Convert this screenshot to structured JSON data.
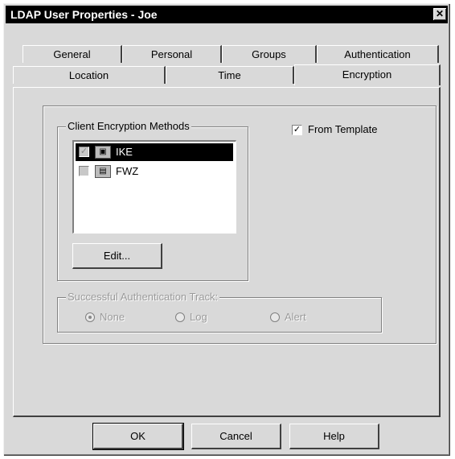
{
  "window": {
    "title": "LDAP User Properties - Joe",
    "close_glyph": "✕"
  },
  "tabs_row1": [
    {
      "label": "General"
    },
    {
      "label": "Personal"
    },
    {
      "label": "Groups"
    },
    {
      "label": "Authentication"
    }
  ],
  "tabs_row2": [
    {
      "label": "Location"
    },
    {
      "label": "Time"
    },
    {
      "label": "Encryption",
      "active": true
    }
  ],
  "client_encryption": {
    "group_label": "Client Encryption Methods",
    "methods": [
      {
        "label": "IKE",
        "checked": true,
        "selected": true,
        "icon": "ike-icon"
      },
      {
        "label": "FWZ",
        "checked": false,
        "selected": false,
        "icon": "fwz-icon"
      }
    ],
    "edit_button": "Edit..."
  },
  "from_template": {
    "label": "From Template",
    "checked": true
  },
  "auth_track": {
    "group_label": "Successful Authentication Track:",
    "options": [
      {
        "label": "None",
        "checked": true
      },
      {
        "label": "Log",
        "checked": false
      },
      {
        "label": "Alert",
        "checked": false
      }
    ]
  },
  "footer": {
    "ok_label": "OK",
    "cancel_label": "Cancel",
    "help_label": "Help"
  }
}
